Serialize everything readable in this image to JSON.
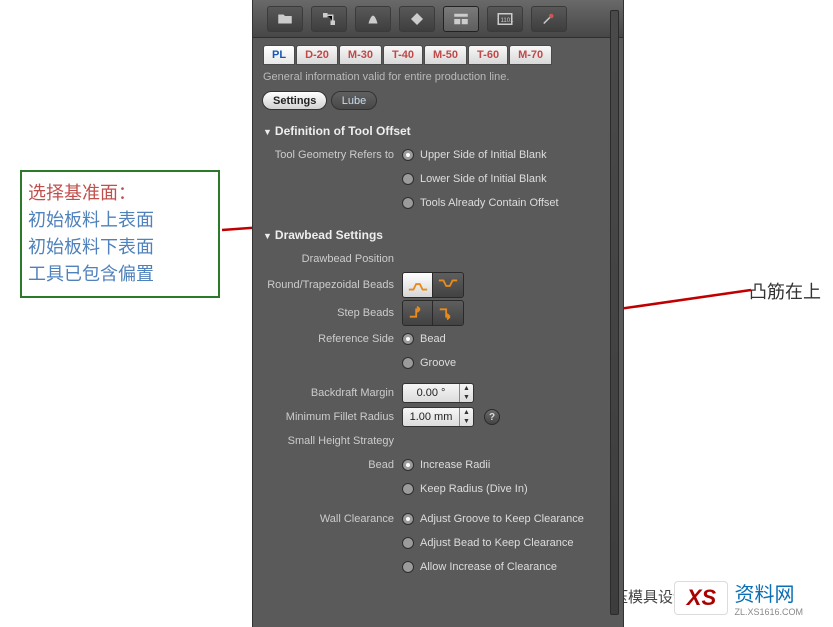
{
  "annotations": {
    "left_title": "选择基准面：",
    "left_line1": "初始板料上表面",
    "left_line2": "初始板料下表面",
    "left_line3": "工具已包含偏置",
    "right": "凸筋在上"
  },
  "logo": {
    "text_prefix": "五金冲压模具设计知识",
    "badge": "XS",
    "zl": "资料网",
    "zl_sub": "ZL.XS1616.COM"
  },
  "toolbar": {
    "icons": [
      "folder-icon",
      "process-icon",
      "shape-icon",
      "diamond-icon",
      "layout-icon",
      "console-icon",
      "pin-icon"
    ]
  },
  "stages": [
    {
      "label": "PL",
      "active": true
    },
    {
      "label": "D-20",
      "active": false
    },
    {
      "label": "M-30",
      "active": false
    },
    {
      "label": "T-40",
      "active": false
    },
    {
      "label": "M-50",
      "active": false
    },
    {
      "label": "T-60",
      "active": false
    },
    {
      "label": "M-70",
      "active": false
    }
  ],
  "info_line": "General information valid for entire production line.",
  "subtabs": [
    {
      "label": "Settings",
      "active": true
    },
    {
      "label": "Lube",
      "active": false
    }
  ],
  "sections": {
    "tool_offset": {
      "title": "Definition of Tool Offset",
      "label": "Tool Geometry Refers to",
      "options": [
        {
          "label": "Upper Side of Initial Blank",
          "on": true
        },
        {
          "label": "Lower Side of Initial Blank",
          "on": false
        },
        {
          "label": "Tools Already Contain Offset",
          "on": false
        }
      ]
    },
    "drawbead": {
      "title": "Drawbead Settings",
      "rows": {
        "position_label": "Drawbead Position",
        "round_label": "Round/Trapezoidal Beads",
        "step_label": "Step Beads",
        "refside_label": "Reference Side",
        "refside_options": [
          {
            "label": "Bead",
            "on": true
          },
          {
            "label": "Groove",
            "on": false
          }
        ],
        "backdraft_label": "Backdraft Margin",
        "backdraft_value": "0.00 °",
        "minfillet_label": "Minimum Fillet Radius",
        "minfillet_value": "1.00 mm",
        "smallheight_label": "Small Height Strategy",
        "bead_label": "Bead",
        "bead_options": [
          {
            "label": "Increase Radii",
            "on": true
          },
          {
            "label": "Keep Radius (Dive In)",
            "on": false
          }
        ],
        "wall_label": "Wall Clearance",
        "wall_options": [
          {
            "label": "Adjust Groove to Keep Clearance",
            "on": true
          },
          {
            "label": "Adjust Bead to Keep Clearance",
            "on": false
          },
          {
            "label": "Allow Increase of Clearance",
            "on": false
          }
        ]
      }
    }
  }
}
